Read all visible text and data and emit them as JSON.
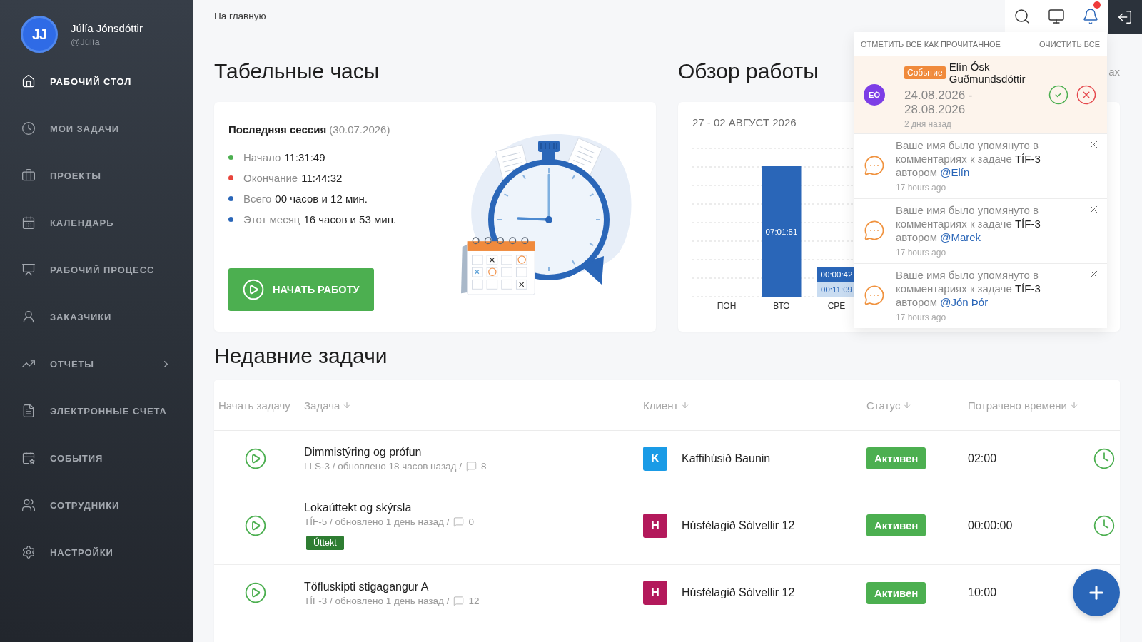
{
  "sidebar": {
    "user": {
      "initials": "JJ",
      "name": "Júlía Jónsdóttir",
      "handle": "@Júlía"
    },
    "items": [
      {
        "label": "РАБОЧИЙ СТОЛ",
        "selected": true,
        "kind": "link"
      },
      {
        "label": "МОИ ЗАДАЧИ",
        "selected": false,
        "kind": "link"
      },
      {
        "label": "ПРОЕКТЫ",
        "selected": false,
        "kind": "link"
      },
      {
        "label": "КАЛЕНДАРЬ",
        "selected": false,
        "kind": "link"
      },
      {
        "label": "РАБОЧИЙ ПРОЦЕСС",
        "selected": false,
        "kind": "link"
      },
      {
        "label": "ЗАКАЗЧИКИ",
        "selected": false,
        "kind": "link"
      },
      {
        "label": "ОТЧЁТЫ",
        "selected": false,
        "kind": "group"
      },
      {
        "label": "ЭЛЕКТРОННЫЕ СЧЕТА",
        "selected": false,
        "kind": "link"
      },
      {
        "label": "СОБЫТИЯ",
        "selected": false,
        "kind": "link"
      },
      {
        "label": "СОТРУДНИКИ",
        "selected": false,
        "kind": "link"
      },
      {
        "label": "НАСТРОЙКИ",
        "selected": false,
        "kind": "link"
      }
    ]
  },
  "breadcrumb": "На главную",
  "toolbar": {
    "unread": true
  },
  "notifications": {
    "mark_all_read": "ОТМЕТИТЬ ВСЕ КАК ПРОЧИТАННОЕ",
    "clear_all": "ОЧИСТИТЬ ВСЕ",
    "items": [
      {
        "kind": "event",
        "initials": "EÓ",
        "badge": "Событие",
        "name": "Elín Ósk Guðmundsdóttir",
        "dates": "24.08.2026 - 28.08.2026",
        "time": "2 дня назад"
      },
      {
        "kind": "mention",
        "text": "Ваше имя было упомянуто в комментариях к задаче **TÍF-3** автором",
        "author": "@Elín",
        "time": "17 hours ago"
      },
      {
        "kind": "mention",
        "text": "Ваше имя было упомянуто в комментариях к задаче **TÍF-3** автором",
        "author": "@Marek",
        "time": "17 hours ago"
      },
      {
        "kind": "mention",
        "text": "Ваше имя было упомянуто в комментариях к задаче **TÍF-3** автором",
        "author": "@Jón Þór",
        "time": "17 hours ago"
      }
    ]
  },
  "timesheet": {
    "title": "Табельные часы",
    "session": "**Последняя сессия** (30.07.2026)",
    "entries": [
      {
        "label": "Начало",
        "value": "11:31:49",
        "color": "#4caf50"
      },
      {
        "label": "Окончание",
        "value": "11:44:32",
        "color": "#e8453c"
      },
      {
        "label": "Всего",
        "value": "00 часов и 12 мин.",
        "color": "#2a66b8"
      },
      {
        "label": "Этот месяц",
        "value": "16 часов и 53 мин.",
        "color": "#2a66b8"
      }
    ],
    "start_button": "НАЧАТЬ РАБОТУ"
  },
  "overview": {
    "title": "Обзор работы",
    "trailing_text": "ах",
    "period": "27 - 02 АВГУСТ 2026",
    "days": [
      {
        "label": "ПОН"
      },
      {
        "label": "ВТО",
        "bars": [
          {
            "label": "07:01:51",
            "kind": "primary"
          }
        ]
      },
      {
        "label": "СРЕ",
        "bars": [
          {
            "label": "00:00:42",
            "kind": "primary"
          },
          {
            "label": "00:11:09",
            "kind": "secondary"
          }
        ]
      }
    ]
  },
  "recent_tasks": {
    "title": "Недавние задачи",
    "columns": [
      {
        "label": "Начать задачу",
        "sortable": false
      },
      {
        "label": "Задача",
        "sortable": true
      },
      {
        "label": "Клиент",
        "sortable": true
      },
      {
        "label": "Статус",
        "sortable": true
      },
      {
        "label": "Потрачено времени",
        "sortable": true
      }
    ],
    "rows": [
      {
        "title": "Dimmistýring og prófun",
        "meta": "LLS-3 / обновлено 18 часов назад /",
        "comments": "8",
        "client": {
          "initial": "K",
          "name": "Kaffihúsið Baunin",
          "color": "#1a9be6"
        },
        "status": "Активен",
        "time": "02:00",
        "timer": true
      },
      {
        "title": "Lokaúttekt og skýrsla",
        "meta": "TÍF-5 / обновлено 1 день назад /",
        "comments": "0",
        "tags": [
          "Úttekt"
        ],
        "client": {
          "initial": "H",
          "name": "Húsfélagið Sólvellir 12",
          "color": "#b3195b"
        },
        "status": "Активен",
        "time": "00:00:00",
        "timer": true
      },
      {
        "title": "Töfluskipti stigagangur A",
        "meta": "TÍF-3 / обновлено 1 день назад /",
        "comments": "12",
        "client": {
          "initial": "H",
          "name": "Húsfélagið Sólvellir 12",
          "color": "#b3195b"
        },
        "status": "Активен",
        "time": "10:00",
        "timer": false
      }
    ]
  }
}
